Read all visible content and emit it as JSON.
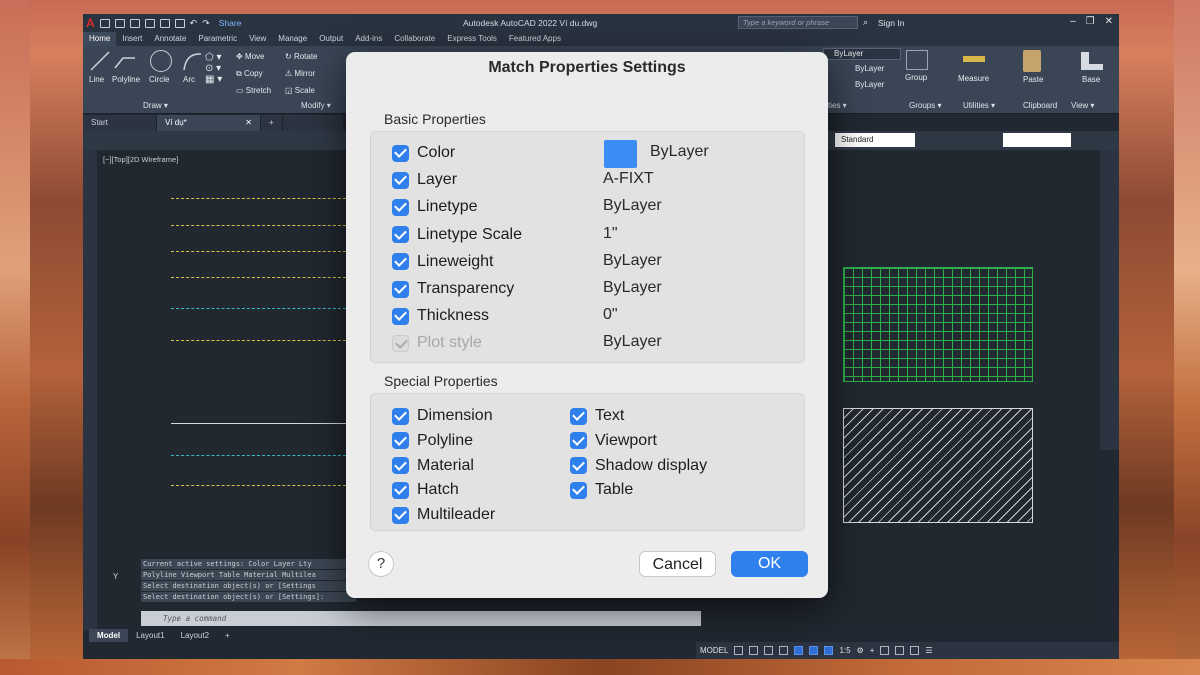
{
  "app": {
    "title": "Autodesk AutoCAD 2022    Ví du.dwg",
    "share": "Share",
    "search_placeholder": "Type a keyword or phrase",
    "signin": "Sign In",
    "ribbon_tabs": [
      "Home",
      "Insert",
      "Annotate",
      "Parametric",
      "View",
      "Manage",
      "Output",
      "Add-ins",
      "Collaborate",
      "Express Tools",
      "Featured Apps"
    ],
    "draw_tools": [
      "Line",
      "Polyline",
      "Circle",
      "Arc"
    ],
    "modify_tools": [
      "Move",
      "Rotate",
      "Copy",
      "Mirror",
      "Stretch",
      "Scale"
    ],
    "panels": {
      "draw": "Draw ▾",
      "modify": "Modify ▾",
      "properties": "ties ▾",
      "groups": "Groups ▾",
      "utilities": "Utilities ▾",
      "clipboard": "Clipboard",
      "view": "View ▾"
    },
    "layer_dropdowns": [
      "ByLayer",
      "ByLayer",
      "ByLayer"
    ],
    "group_label": "Group",
    "measure_label": "Measure",
    "paste_label": "Paste",
    "base_label": "Base",
    "doc_tabs": [
      "Start",
      "Ví dụ*"
    ],
    "style_dropdown": "Standard",
    "viewport_label": "[−][Top][2D Wireframe]",
    "command_history": [
      "Current active settings:  Color Layer Lty",
      "Polyline Viewport Table Material Multilea",
      "Select destination object(s) or [Settings",
      "Select destination object(s) or [Settings]:"
    ],
    "command_placeholder": "Type a command",
    "layout_tabs": [
      "Model",
      "Layout1",
      "Layout2",
      "+"
    ],
    "status_model": "MODEL",
    "status_scale": "1:5",
    "ucs_y": "Y"
  },
  "dialog": {
    "title": "Match Properties Settings",
    "basic_header": "Basic Properties",
    "basic": [
      {
        "label": "Color",
        "value": "ByLayer",
        "checked": true,
        "disabled": false
      },
      {
        "label": "Layer",
        "value": "A-FIXT",
        "checked": true,
        "disabled": false
      },
      {
        "label": "Linetype",
        "value": "ByLayer",
        "checked": true,
        "disabled": false
      },
      {
        "label": "Linetype Scale",
        "value": "1\"",
        "checked": true,
        "disabled": false
      },
      {
        "label": "Lineweight",
        "value": "ByLayer",
        "checked": true,
        "disabled": false
      },
      {
        "label": "Transparency",
        "value": "ByLayer",
        "checked": true,
        "disabled": false
      },
      {
        "label": "Thickness",
        "value": "0\"",
        "checked": true,
        "disabled": false
      },
      {
        "label": "Plot style",
        "value": "ByLayer",
        "checked": true,
        "disabled": true
      }
    ],
    "color_swatch": "#3b8cf5",
    "special_header": "Special Properties",
    "special_left": [
      "Dimension",
      "Polyline",
      "Material",
      "Hatch",
      "Multileader"
    ],
    "special_right": [
      "Text",
      "Viewport",
      "Shadow display",
      "Table"
    ],
    "help_label": "?",
    "cancel_label": "Cancel",
    "ok_label": "OK"
  }
}
